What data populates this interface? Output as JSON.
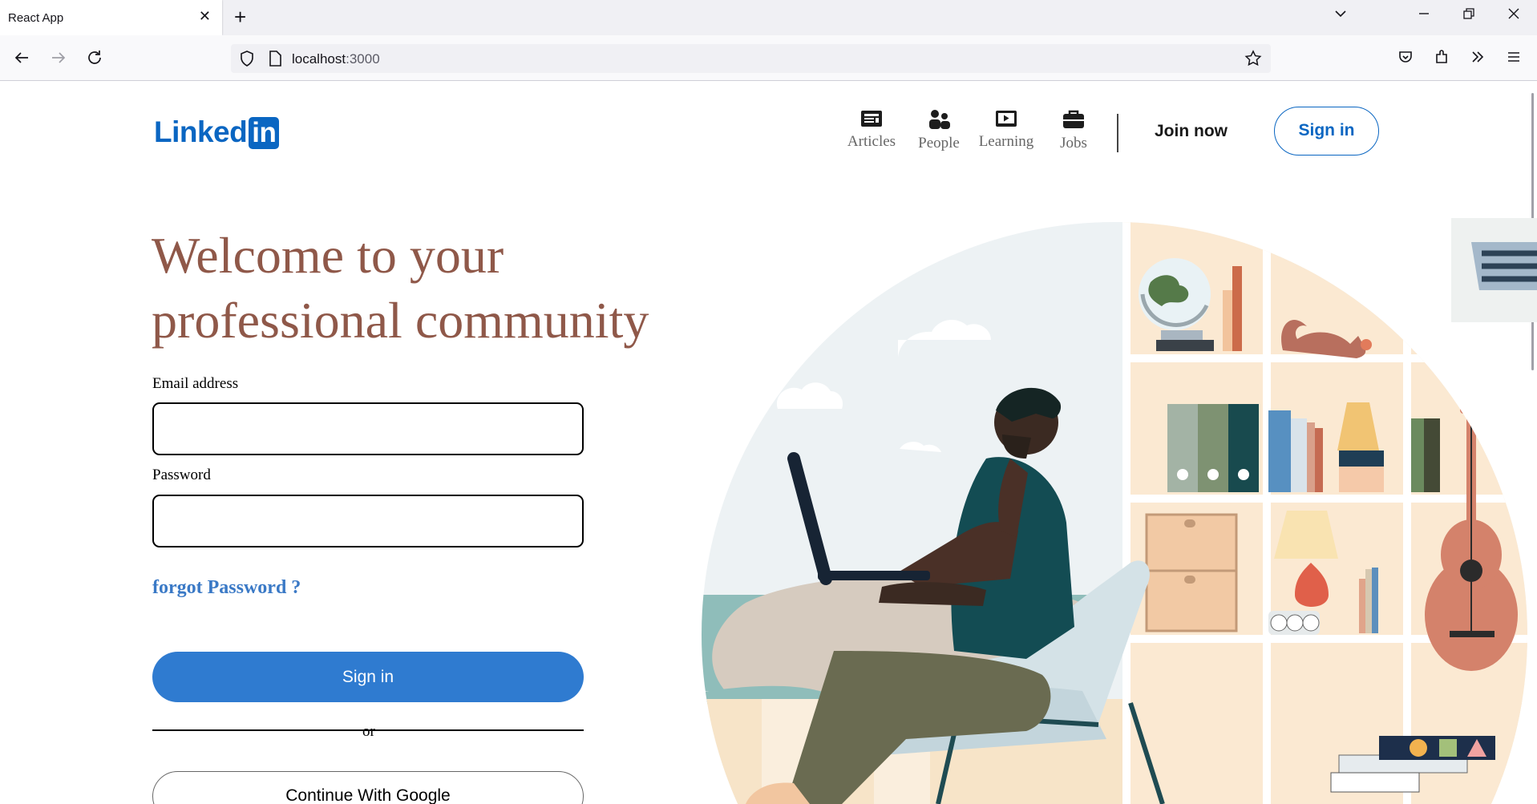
{
  "browser": {
    "tab_title": "React App",
    "tab_close": "✕",
    "new_tab": "+",
    "url_host": "localhost",
    "url_port": ":3000"
  },
  "header": {
    "logo_text": "Linked",
    "logo_badge": "in",
    "nav": [
      {
        "label": "Articles",
        "icon": "articles-icon"
      },
      {
        "label": "People",
        "icon": "people-icon"
      },
      {
        "label": "Learning",
        "icon": "learning-icon"
      },
      {
        "label": "Jobs",
        "icon": "jobs-icon"
      }
    ],
    "join_label": "Join now",
    "signin_label": "Sign in"
  },
  "hero": {
    "headline_line1": "Welcome to your",
    "headline_line2": "professional community"
  },
  "form": {
    "email_label": "Email address",
    "email_value": "",
    "password_label": "Password",
    "password_value": "",
    "forgot_label": "forgot Password ?",
    "signin_label": "Sign in",
    "divider_text": "or",
    "google_label": "Continue With Google"
  },
  "colors": {
    "brand": "#0a66c2",
    "headline": "#8f5849",
    "primary_button": "#2f7bd0",
    "forgot_link": "#3a79c6"
  }
}
